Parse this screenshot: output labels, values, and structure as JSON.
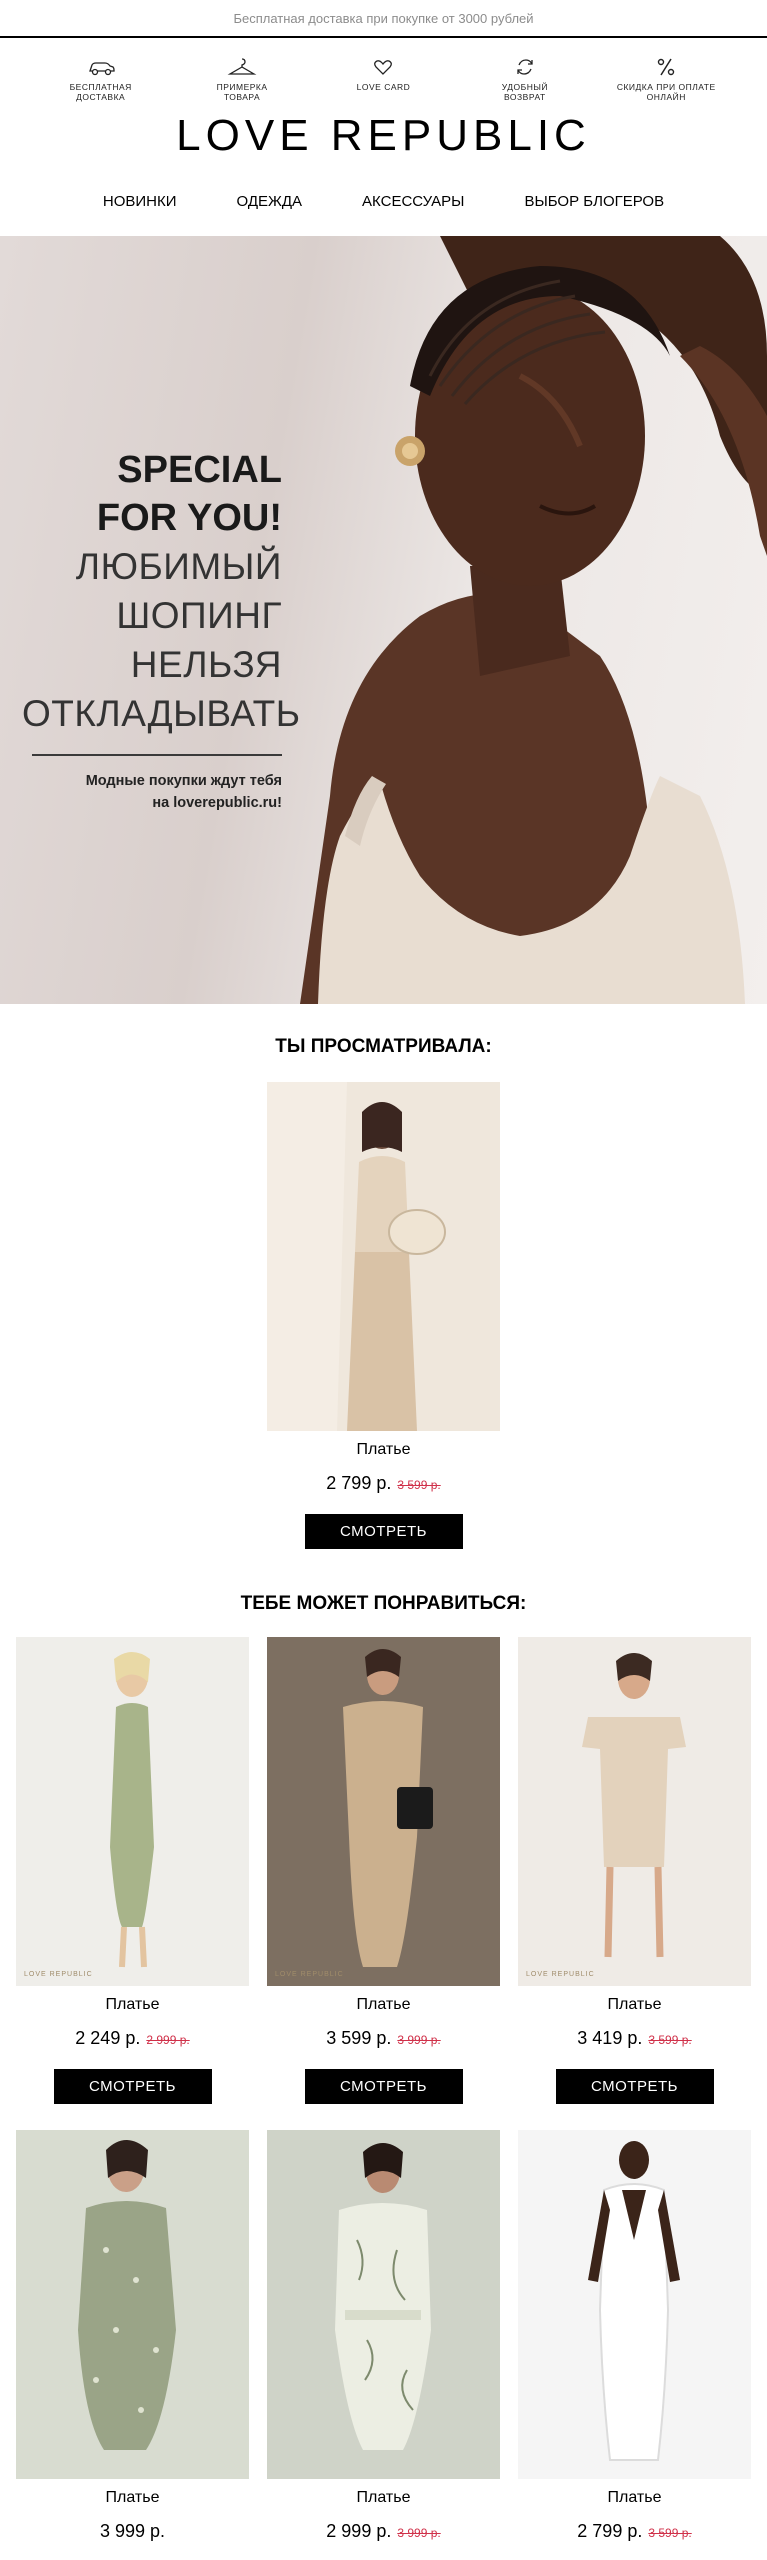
{
  "topbar": {
    "text": "Бесплатная доставка при покупке от 3000 рублей"
  },
  "features": [
    {
      "icon": "car-icon",
      "label": "Бесплатная\nдоставка"
    },
    {
      "icon": "hanger-icon",
      "label": "Примерка\nтовара"
    },
    {
      "icon": "heart-icon",
      "label": "Love card"
    },
    {
      "icon": "refresh-icon",
      "label": "Удобный\nвозврат"
    },
    {
      "icon": "percent-icon",
      "label": "Скидка при оплате\nонлайн"
    }
  ],
  "brand": {
    "logo": "LOVE REPUBLIC"
  },
  "nav": [
    "НОВИНКИ",
    "ОДЕЖДА",
    "АКСЕССУАРЫ",
    "ВЫБОР БЛОГЕРОВ"
  ],
  "hero": {
    "line1": "SPECIAL",
    "line2": "FOR YOU!",
    "line3": "ЛЮБИМЫЙ",
    "line4": "ШОПИНГ",
    "line5": "НЕЛЬЗЯ",
    "line6": "ОТКЛАДЫВАТЬ",
    "note1": "Модные покупки ждут тебя",
    "note2": "на loverepublic.ru!"
  },
  "viewed": {
    "title": "ТЫ ПРОСМАТРИВАЛА:",
    "item": {
      "name": "Платье",
      "price": "2 799 р.",
      "old_price": "3 599 р.",
      "button": "СМОТРЕТЬ"
    }
  },
  "recommended": {
    "title": "ТЕБЕ МОЖЕТ ПОНРАВИТЬСЯ:",
    "brand_mark": "LOVE REPUBLIC",
    "items": [
      {
        "name": "Платье",
        "price": "2 249 р.",
        "old_price": "2 999 р.",
        "button": "СМОТРЕТЬ"
      },
      {
        "name": "Платье",
        "price": "3 599 р.",
        "old_price": "3 999 р.",
        "button": "СМОТРЕТЬ"
      },
      {
        "name": "Платье",
        "price": "3 419 р.",
        "old_price": "3 599 р.",
        "button": "СМОТРЕТЬ"
      },
      {
        "name": "Платье",
        "price": "3 999 р.",
        "old_price": ""
      },
      {
        "name": "Платье",
        "price": "2 999 р.",
        "old_price": "3 999 р."
      },
      {
        "name": "Платье",
        "price": "2 799 р.",
        "old_price": "3 599 р."
      }
    ]
  },
  "colors": {
    "sale": "#d0314a",
    "button": "#000000",
    "topbar_text": "#8c8c8c"
  }
}
